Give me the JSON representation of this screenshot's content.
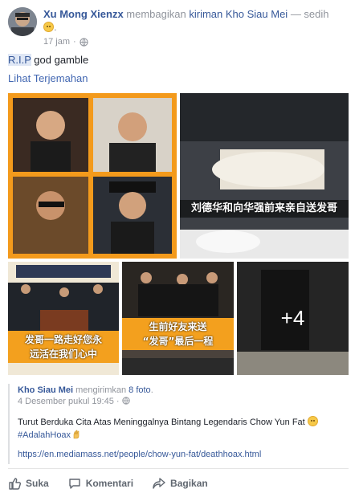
{
  "header": {
    "author": "Xu Mong Xienzx",
    "action": "membagikan",
    "source": "kiriman Kho Siau Mei",
    "feeling": "— sedih",
    "feeling_tail": ".",
    "time": "17 jam",
    "separator": "·"
  },
  "post": {
    "rip": "R.I.P",
    "text": " god gamble",
    "translate": "Lihat Terjemahan"
  },
  "photos": {
    "caption_1": "刘德华和向华强前来亲自送发哥",
    "caption_2_line1": "发哥一路走好您永",
    "caption_2_line2": "远活在我们心中",
    "caption_3_line1": "生前好友来送",
    "caption_3_line2": "“发哥”最后一程",
    "more_count": "+4"
  },
  "shared": {
    "author": "Kho Siau Mei",
    "verb": "mengirimkan",
    "count_link": "8 foto",
    "count_tail": ".",
    "date": "4 Desember pukul 19:45",
    "separator": "·",
    "body": "Turut Berduka Cita Atas Meninggalnya Bintang Legendaris Chow Yun Fat",
    "hashtag": "#AdalahHoax",
    "url": "https://en.mediamass.net/people/chow-yun-fat/deathhoax.html"
  },
  "actions": {
    "like": "Suka",
    "comment": "Komentari",
    "share": "Bagikan"
  },
  "colors": {
    "link": "#365899",
    "meta": "#90949c",
    "text": "#1d2129"
  }
}
